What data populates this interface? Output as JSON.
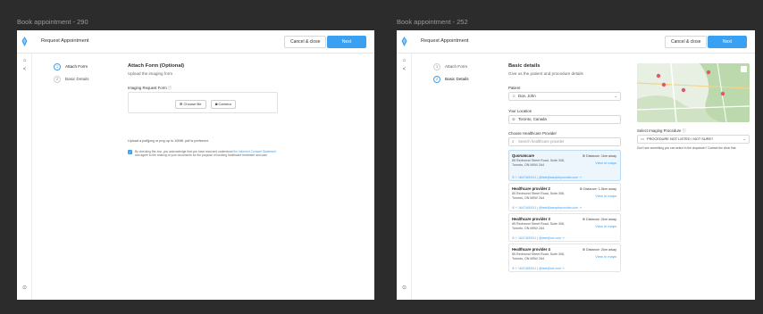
{
  "frames": [
    {
      "label": "Book appointment - 290",
      "header": {
        "title": "Request Appointment",
        "cancel_label": "Cancel & close",
        "next_label": "Next"
      },
      "steps": [
        {
          "num": "1",
          "label": "Attach Form"
        },
        {
          "num": "2",
          "label": "Basic Details"
        }
      ],
      "form": {
        "heading": "Attach Form (Optional)",
        "subheading": "Upload the imaging form",
        "field_label": "Imaging Request Form",
        "choose_file_label": "Choose file",
        "camera_label": "Camera",
        "hint": "Upload a pdf/jpeg or png up to 10MB. pdf is preferred.",
        "consent_prefix": "By checking this box, you acknowledge that you have read and understood ",
        "consent_link": "the Informed Consent Statement",
        "consent_suffix": " and agree to the sharing of your documents for the purpose of booking healthcare treatment and care"
      }
    },
    {
      "label": "Book appointment - 252",
      "header": {
        "title": "Request Appointment",
        "cancel_label": "Cancel & close",
        "next_label": "Next"
      },
      "steps": [
        {
          "num": "1",
          "label": "Attach Form"
        },
        {
          "num": "2",
          "label": "Basic Details"
        }
      ],
      "form": {
        "heading": "Basic details",
        "subheading": "Give us the patient and procedure details",
        "patient_label": "Patient",
        "patient_value": "Doe, John",
        "location_label": "Your Location",
        "location_value": "Toronto, Canada",
        "provider_label": "Choose Healthcare Provider",
        "search_placeholder": "Search healthcare provider",
        "procedure_label": "Select Imaging Procedure",
        "procedure_value": "PROCEDURE NOT LISTED / NOT SURE?",
        "procedure_hint": "Don't see something you can select in the dropdown? Contact the clinic first."
      },
      "providers": [
        {
          "name": "Quorumcare",
          "distance": "Distance: 1km away",
          "addr1": "85 Redmond Street Road, Suite 308,",
          "addr2": "Toronto, ON M5W 2A4",
          "phone": "+ 1647445XX1",
          "email": "test@sampleprovider.com"
        },
        {
          "name": "Healthcare provider 2",
          "distance": "Distance: 1.5km away",
          "addr1": "85 Redmond Street Road, Suite 308,",
          "addr2": "Toronto, ON M5W 2A4",
          "phone": "+ 1647445XX1",
          "email": "test@sampleprovider.com"
        },
        {
          "name": "Healthcare provider 3",
          "distance": "Distance: 2km away",
          "addr1": "85 Redmond Street Road, Suite 308,",
          "addr2": "Toronto, ON M5W 2A4",
          "phone": "+ 1647445XX1",
          "email": "test@xxt.com"
        },
        {
          "name": "Healthcare provider 4",
          "distance": "Distance: 2km away",
          "addr1": "85 Redmond Street Road, Suite 308,",
          "addr2": "Toronto, ON M5W 2A4",
          "phone": "+ 1647445XX1",
          "email": "test@xxt.com"
        }
      ],
      "view_in_maps": "View in maps"
    }
  ],
  "colors": {
    "accent": "#3aa0f2",
    "selected_card": "#eef6fd"
  }
}
